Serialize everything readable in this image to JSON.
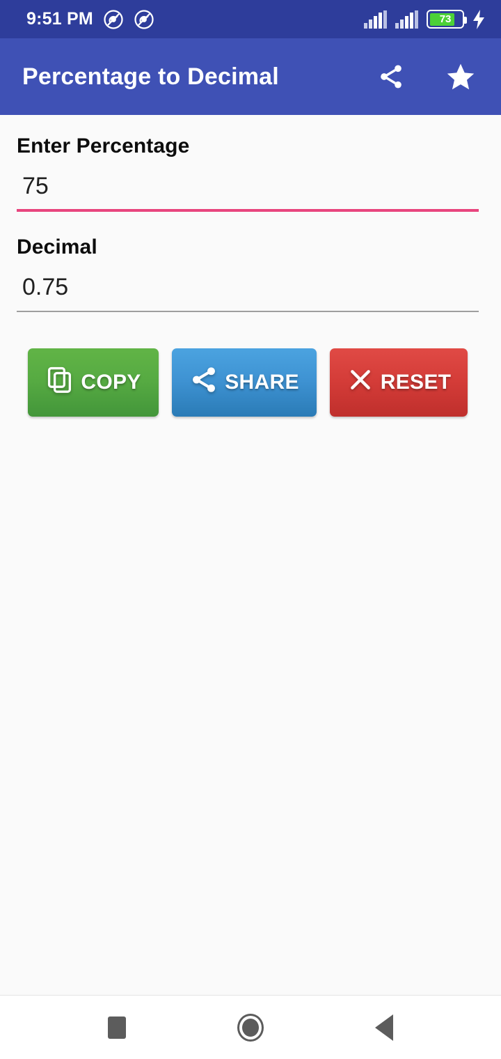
{
  "status_bar": {
    "time": "9:51 PM",
    "battery_percent": "73",
    "icons": [
      "silent-mode-icon",
      "silent-mode-icon",
      "signal-bars-icon",
      "signal-bars-icon",
      "battery-icon",
      "charging-bolt-icon"
    ],
    "background_color": "#2e3d9b"
  },
  "app_bar": {
    "title": "Percentage to Decimal",
    "share_icon": "share-icon",
    "favorite_icon": "star-icon",
    "background_color": "#3f51b5"
  },
  "form": {
    "input": {
      "label": "Enter Percentage",
      "value": "75",
      "placeholder": "",
      "underline_color": "#e8457e"
    },
    "output": {
      "label": "Decimal",
      "value": "0.75",
      "underline_color": "#9e9e9e"
    }
  },
  "buttons": [
    {
      "label": "COPY",
      "icon": "copy-icon",
      "color": "#4cae4c"
    },
    {
      "label": "SHARE",
      "icon": "share-icon",
      "color": "#3e92d2"
    },
    {
      "label": "RESET",
      "icon": "close-x-icon",
      "color": "#d43c38"
    }
  ],
  "nav_bar": {
    "recents": "recents-square-icon",
    "home": "home-circle-icon",
    "back": "back-triangle-icon"
  }
}
